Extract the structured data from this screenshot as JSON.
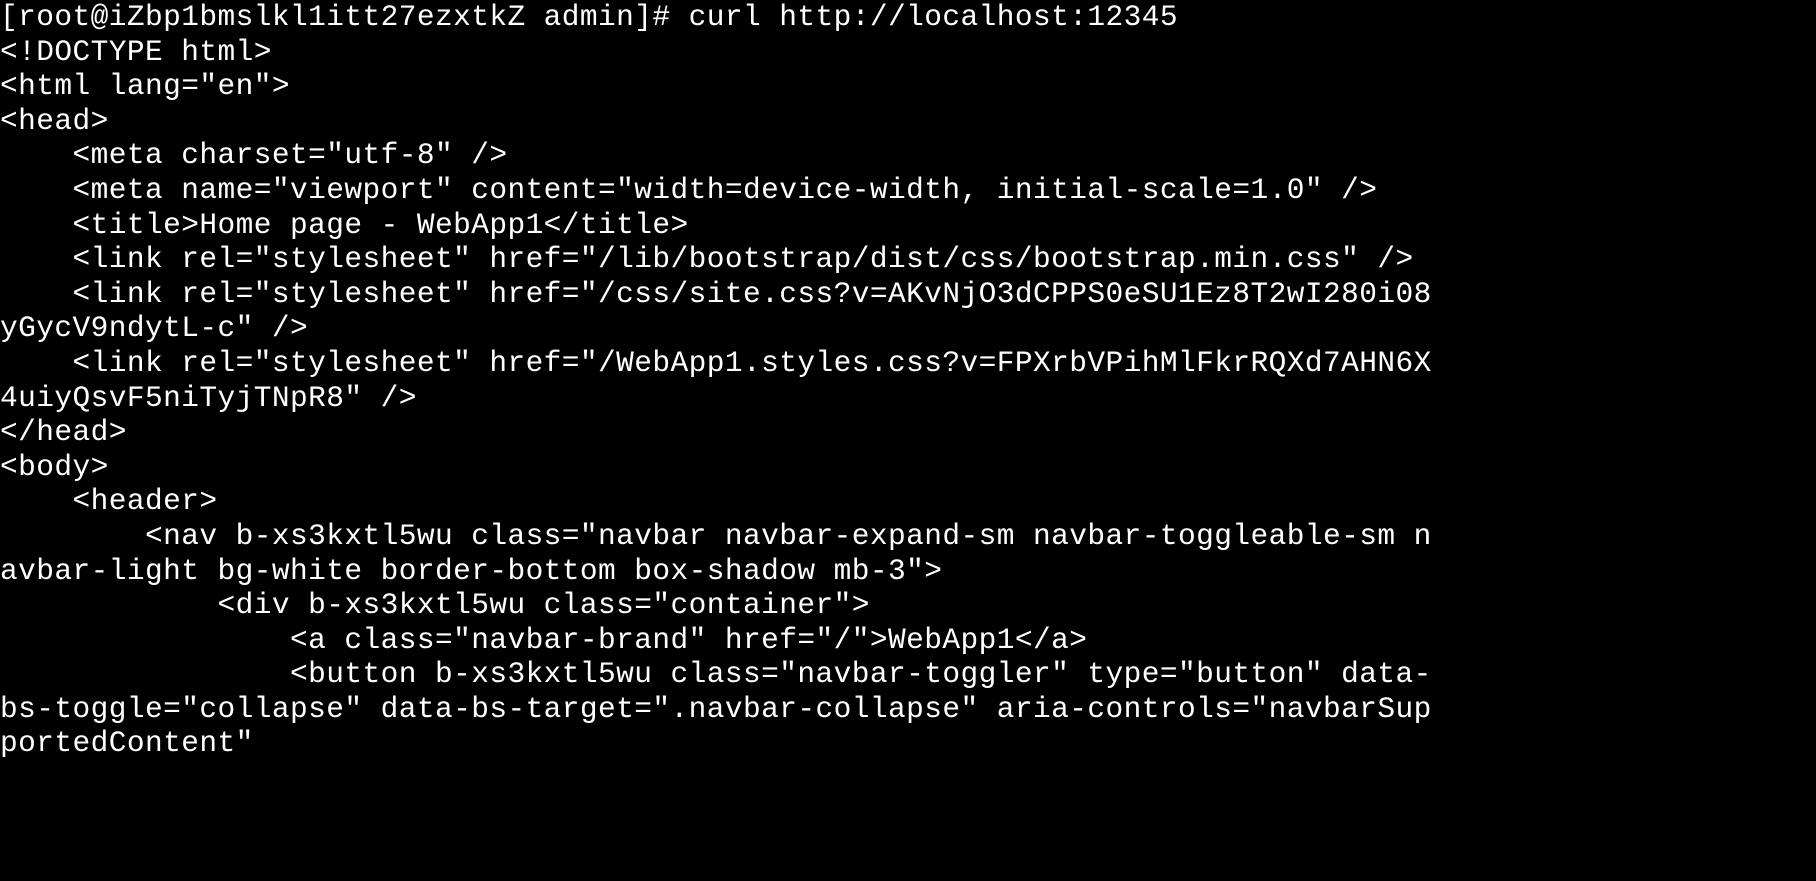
{
  "terminal": {
    "window_type": "console-terminal",
    "colors": {
      "background": "#000000",
      "foreground": "#ffffff"
    },
    "prompt": {
      "user": "root",
      "host": "iZbp1bmslkl1itt27ezxtkZ",
      "cwd": "admin",
      "symbol": "#",
      "full": "[root@iZbp1bmslkl1itt27ezxtkZ admin]#"
    },
    "command": "curl http://localhost:12345",
    "lines": [
      "[root@iZbp1bmslkl1itt27ezxtkZ admin]# curl http://localhost:12345",
      "<!DOCTYPE html>",
      "<html lang=\"en\">",
      "<head>",
      "    <meta charset=\"utf-8\" />",
      "    <meta name=\"viewport\" content=\"width=device-width, initial-scale=1.0\" />",
      "    <title>Home page - WebApp1</title>",
      "    <link rel=\"stylesheet\" href=\"/lib/bootstrap/dist/css/bootstrap.min.css\" />",
      "    <link rel=\"stylesheet\" href=\"/css/site.css?v=AKvNjO3dCPPS0eSU1Ez8T2wI280i08",
      "yGycV9ndytL-c\" />",
      "    <link rel=\"stylesheet\" href=\"/WebApp1.styles.css?v=FPXrbVPihMlFkrRQXd7AHN6X",
      "4uiyQsvF5niTyjTNpR8\" />",
      "</head>",
      "<body>",
      "    <header>",
      "        <nav b-xs3kxtl5wu class=\"navbar navbar-expand-sm navbar-toggleable-sm n",
      "avbar-light bg-white border-bottom box-shadow mb-3\">",
      "            <div b-xs3kxtl5wu class=\"container\">",
      "                <a class=\"navbar-brand\" href=\"/\">WebApp1</a>",
      "                <button b-xs3kxtl5wu class=\"navbar-toggler\" type=\"button\" data-",
      "bs-toggle=\"collapse\" data-bs-target=\".navbar-collapse\" aria-controls=\"navbarSup",
      "portedContent\""
    ]
  }
}
